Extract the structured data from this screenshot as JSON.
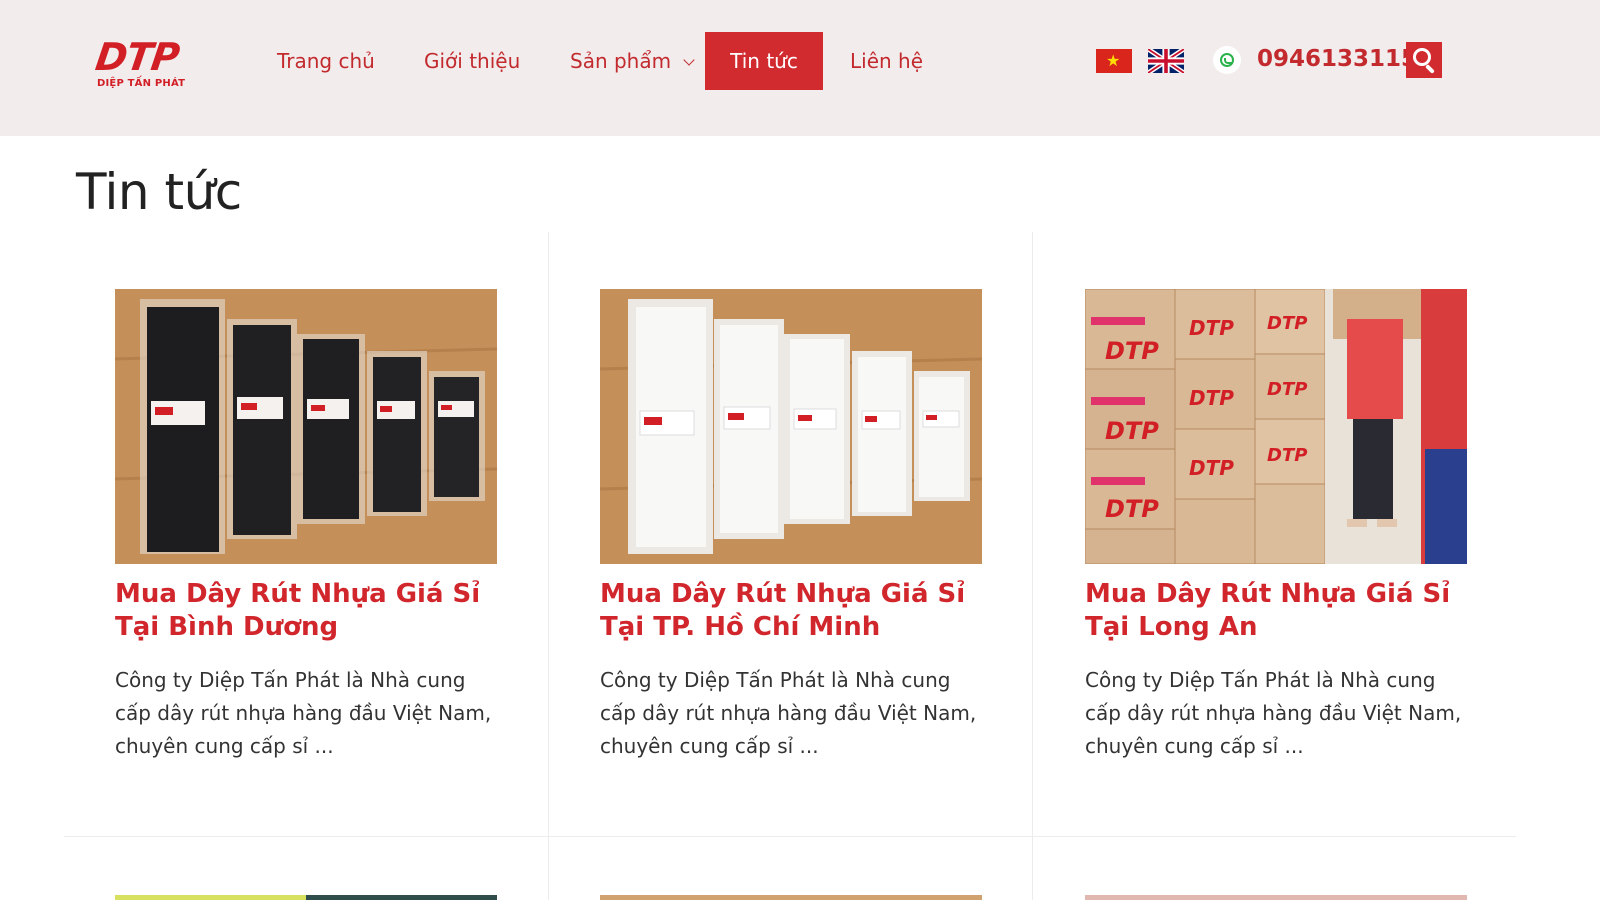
{
  "brand": {
    "logo_mark": "DTP",
    "logo_sub": "DIỆP TẤN PHÁT",
    "accent": "#d12a2f",
    "header_bg": "#f2eced"
  },
  "nav": {
    "items": [
      {
        "label": "Trang chủ"
      },
      {
        "label": "Giới thiệu"
      },
      {
        "label": "Sản phẩm"
      },
      {
        "label": "Tin tức"
      },
      {
        "label": "Liên hệ"
      }
    ],
    "active_label": "Tin tức"
  },
  "header": {
    "flags": [
      "vietnam-flag-icon",
      "uk-flag-icon"
    ],
    "phone": "0946133115",
    "phone_icon": "phone-icon",
    "search_icon": "search-icon"
  },
  "page": {
    "title": "Tin tức"
  },
  "posts": [
    {
      "title": "Mua Dây Rút Nhựa Giá Sỉ Tại Bình Dương",
      "excerpt": "Công ty Diệp Tấn Phát là Nhà cung cấp dây rút nhựa hàng đầu Việt Nam, chuyên cung cấp sỉ ...",
      "image": "black-cable-ties-photo"
    },
    {
      "title": "Mua Dây Rút Nhựa Giá Sỉ Tại TP. Hồ Chí Minh",
      "excerpt": "Công ty Diệp Tấn Phát là Nhà cung cấp dây rút nhựa hàng đầu Việt Nam, chuyên cung cấp sỉ ...",
      "image": "white-cable-ties-photo"
    },
    {
      "title": "Mua Dây Rút Nhựa Giá Sỉ Tại Long An",
      "excerpt": "Công ty Diệp Tấn Phát là Nhà cung cấp dây rút nhựa hàng đầu Việt Nam, chuyên cung cấp sỉ ...",
      "image": "warehouse-boxes-photo"
    }
  ]
}
